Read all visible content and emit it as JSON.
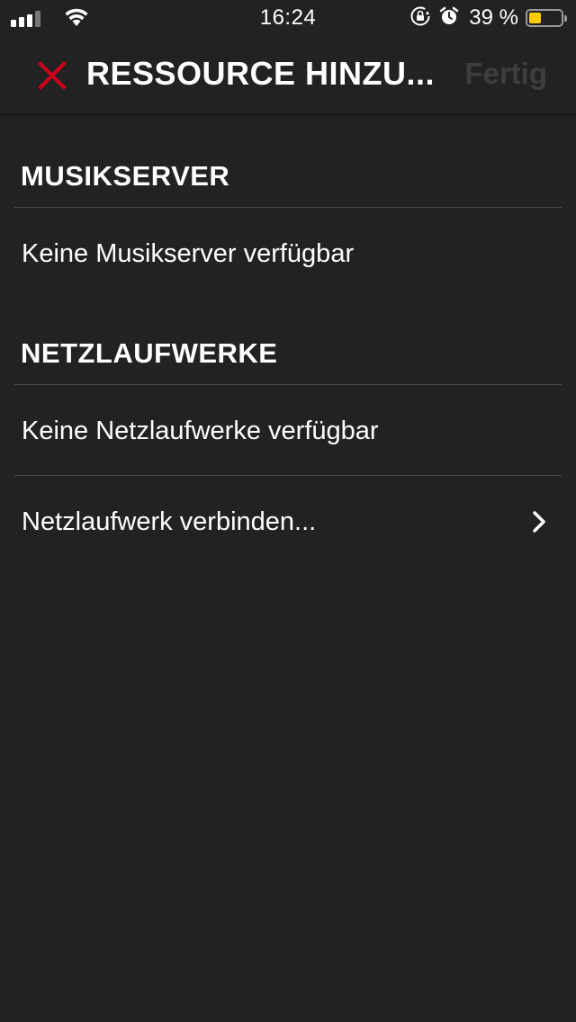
{
  "status_bar": {
    "time": "16:24",
    "battery_percent_text": "39 %",
    "battery_level": 0.39,
    "signal_bars_active": 3,
    "signal_bars_total": 4,
    "icons": [
      "signal-icon",
      "wifi-icon",
      "orientation-lock-icon",
      "alarm-icon",
      "battery-icon"
    ],
    "battery_color": "#ffcc00"
  },
  "nav": {
    "title": "RESSOURCE HINZU...",
    "done_label": "Fertig",
    "close_icon": "close-icon",
    "close_color": "#d0021b"
  },
  "sections": {
    "music": {
      "header": "MUSIKSERVER",
      "empty_text": "Keine Musikserver verfügbar"
    },
    "network": {
      "header": "NETZLAUFWERKE",
      "empty_text": "Keine Netzlaufwerke verfügbar",
      "connect_label": "Netzlaufwerk verbinden..."
    }
  },
  "theme": {
    "background": "#222222",
    "text": "#ffffff",
    "disabled_text": "#3e3e3e",
    "divider": "#4a4a4a"
  }
}
